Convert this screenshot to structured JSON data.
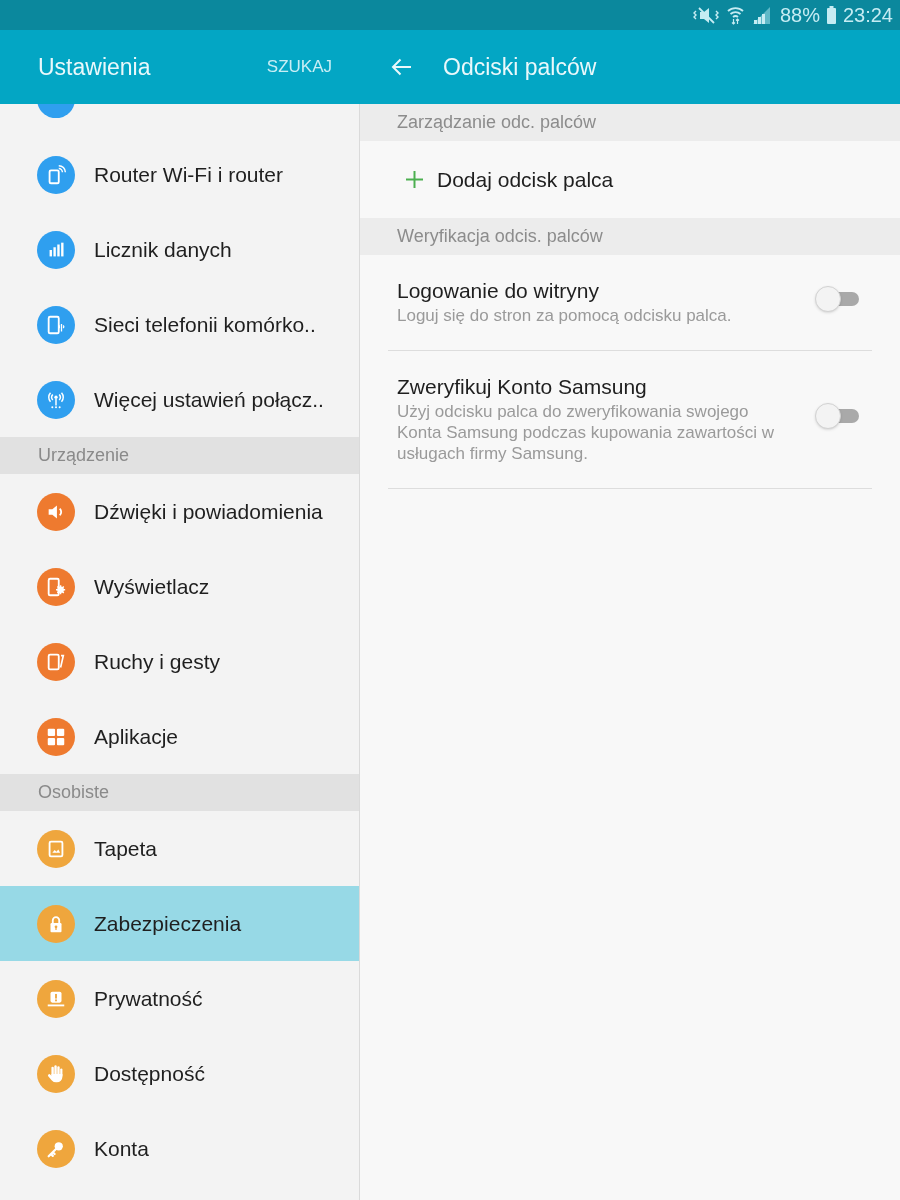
{
  "status_bar": {
    "battery": "88%",
    "time": "23:24"
  },
  "sidebar": {
    "title": "Ustawienia",
    "search_button": "SZUKAJ",
    "sections": [
      {
        "items": [
          {
            "kind": "cut_off",
            "color": "#2f9fef",
            "selected": false
          },
          {
            "kind": "entry",
            "label": "Router Wi-Fi i router",
            "color": "#2f9fef",
            "selected": false
          },
          {
            "kind": "entry",
            "label": "Licznik danych",
            "color": "#2f9fef",
            "selected": false
          },
          {
            "kind": "entry",
            "label": "Sieci telefonii komórko..",
            "color": "#2f9fef",
            "selected": false
          },
          {
            "kind": "entry",
            "label": "Więcej ustawień połącz..",
            "color": "#2f9fef",
            "selected": false
          }
        ]
      },
      {
        "header": "Urządzenie",
        "items": [
          {
            "kind": "entry",
            "label": "Dźwięki i powiadomienia",
            "color": "#ee7a2f",
            "selected": false
          },
          {
            "kind": "entry",
            "label": "Wyświetlacz",
            "color": "#ee7a2f",
            "selected": false
          },
          {
            "kind": "entry",
            "label": "Ruchy i gesty",
            "color": "#ee7a2f",
            "selected": false
          },
          {
            "kind": "entry",
            "label": "Aplikacje",
            "color": "#ee7a2f",
            "selected": false
          }
        ]
      },
      {
        "header": "Osobiste",
        "items": [
          {
            "kind": "entry",
            "label": "Tapeta",
            "color": "#efa63d",
            "selected": false
          },
          {
            "kind": "entry",
            "label": "Zabezpieczenia",
            "color": "#efa63d",
            "selected": true
          },
          {
            "kind": "entry",
            "label": "Prywatność",
            "color": "#efa63d",
            "selected": false
          },
          {
            "kind": "entry",
            "label": "Dostępność",
            "color": "#efa63d",
            "selected": false
          },
          {
            "kind": "entry",
            "label": "Konta",
            "color": "#efa63d",
            "selected": false
          }
        ]
      }
    ]
  },
  "detail": {
    "title": "Odciski palców",
    "sections": [
      {
        "header": "Zarządzanie odc. palców",
        "items": [
          {
            "kind": "action",
            "label": "Dodaj odcisk palca"
          }
        ]
      },
      {
        "header": "Weryfikacja odcis. palców",
        "items": [
          {
            "kind": "switch",
            "title": "Logowanie do witryny",
            "description": "Loguj się do stron za pomocą odcisku palca.",
            "on": false
          },
          {
            "kind": "switch",
            "title": "Zweryfikuj Konto Samsung",
            "description": "Użyj odcisku palca do zweryfikowania swojego Konta Samsung podczas kupowania zawartości w usługach firmy Samsung.",
            "on": false
          }
        ]
      }
    ]
  }
}
